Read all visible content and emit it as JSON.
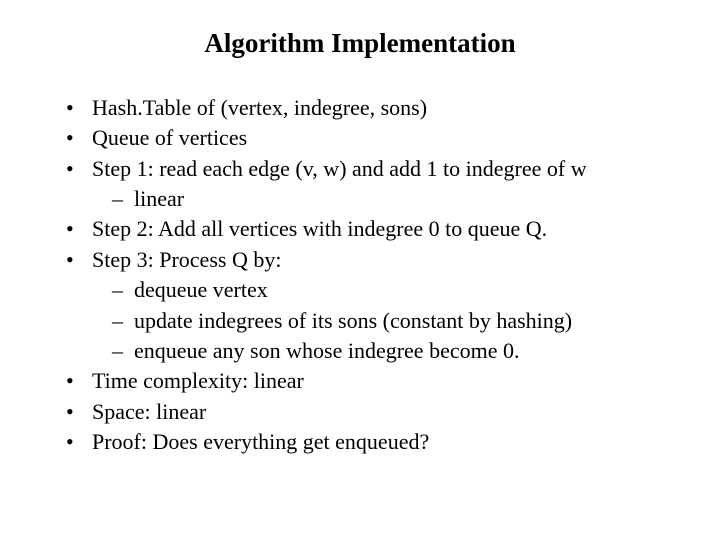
{
  "title": "Algorithm Implementation",
  "bullets": {
    "b0": "Hash.Table of  (vertex, indegree, sons)",
    "b1": "Queue of vertices",
    "b2": "Step 1:  read each edge (v, w) and add 1 to indegree of w",
    "b2_sub0": "linear",
    "b3": "Step 2: Add all vertices with indegree 0 to queue Q.",
    "b4": "Step 3: Process Q by:",
    "b4_sub0": "dequeue vertex",
    "b4_sub1": "update indegrees of its sons (constant by hashing)",
    "b4_sub2": "enqueue any son whose indegree become 0.",
    "b5": "Time complexity: linear",
    "b6": "Space: linear",
    "b7": "Proof: Does everything get enqueued?"
  }
}
